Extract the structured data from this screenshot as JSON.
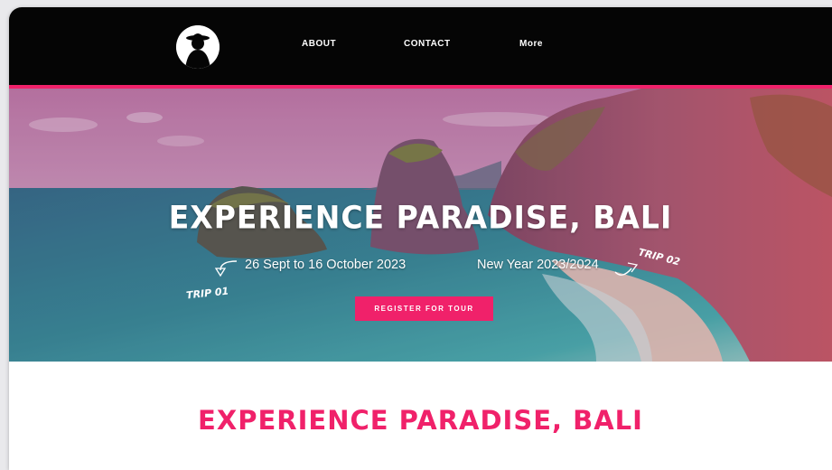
{
  "nav": {
    "logo": "explorer-silhouette-logo",
    "links": [
      "ABOUT",
      "CONTACT",
      "More"
    ]
  },
  "hero": {
    "title": "EXPERIENCE PARADISE, BALI",
    "trip1": {
      "label": "TRIP 01",
      "dates": "26 Sept to 16 October 2023"
    },
    "trip2": {
      "label": "TRIP 02",
      "dates": "New Year 2023/2024"
    },
    "register_label": "REGISTER FOR TOUR"
  },
  "section": {
    "title": "EXPERIENCE PARADISE, BALI"
  },
  "colors": {
    "accent": "#f0216a",
    "nav_bg": "#050505",
    "text_light": "#ffffff"
  }
}
